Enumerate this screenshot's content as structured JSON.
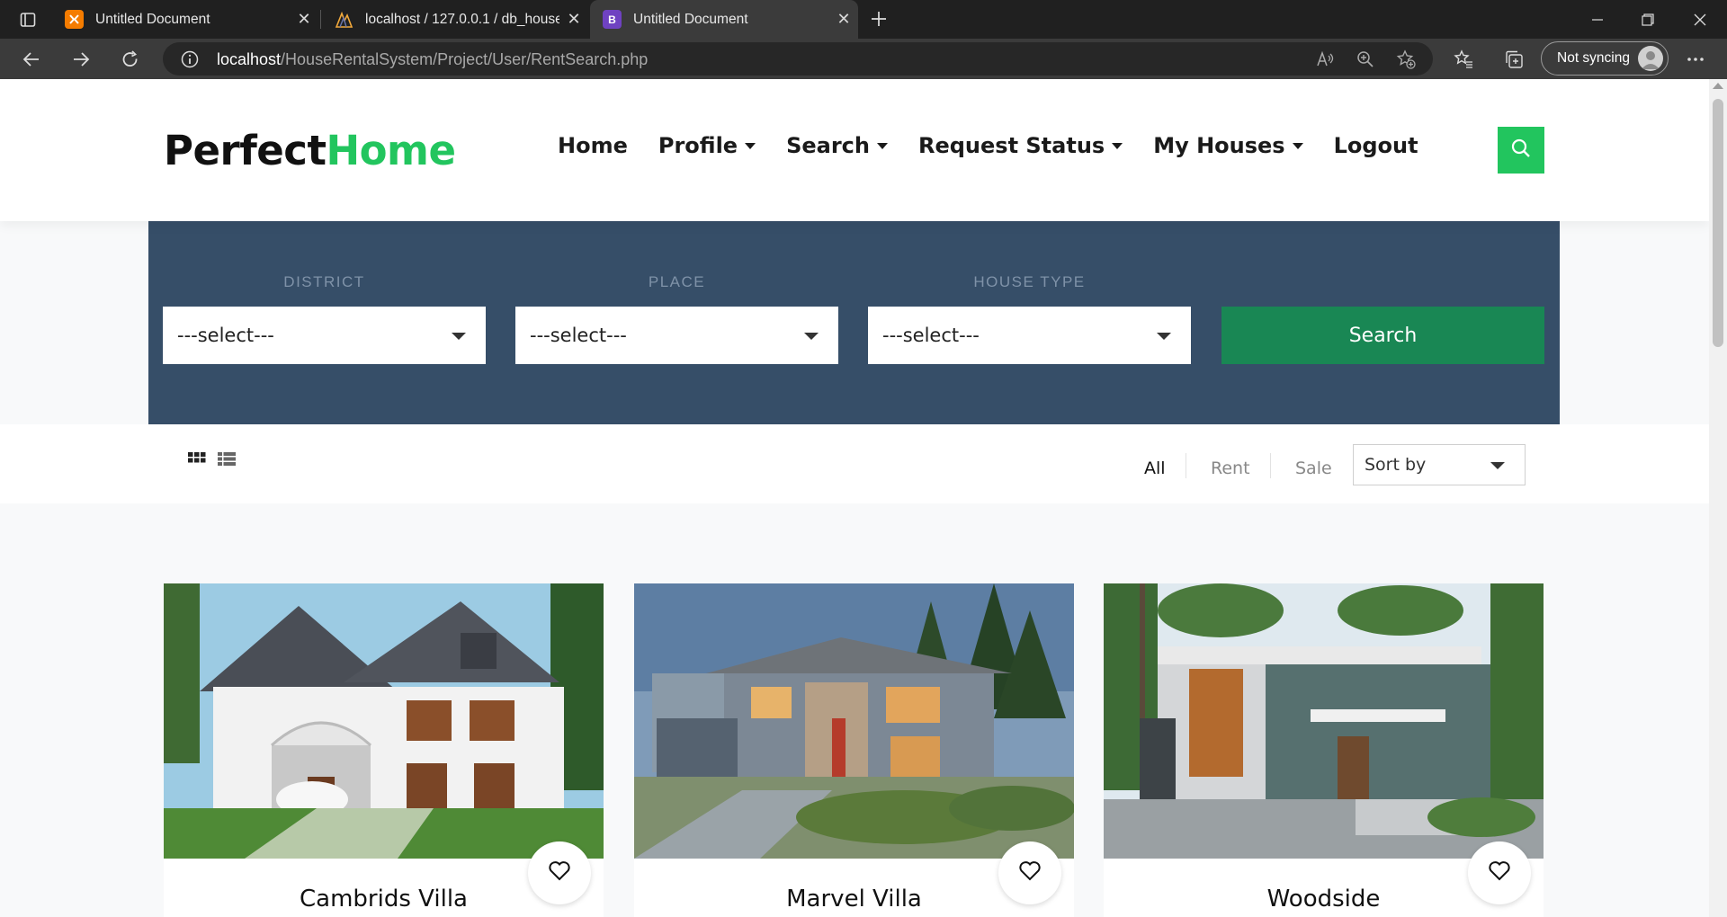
{
  "browser": {
    "tabs": [
      {
        "title": "Untitled Document",
        "favicon": "xampp-icon",
        "active": false
      },
      {
        "title": "localhost / 127.0.0.1 / db_housere",
        "favicon": "phpmyadmin-icon",
        "active": false
      },
      {
        "title": "Untitled Document",
        "favicon": "bootstrap-icon",
        "active": true
      }
    ],
    "url_host": "localhost",
    "url_path": "/HouseRentalSystem/Project/User/RentSearch.php",
    "sync_label": "Not syncing"
  },
  "header": {
    "logo_part1": "Perfect",
    "logo_part2": "Home",
    "nav": {
      "home": "Home",
      "profile": "Profile",
      "search": "Search",
      "request_status": "Request Status",
      "my_houses": "My Houses",
      "logout": "Logout"
    }
  },
  "filters": {
    "district_label": "DISTRICT",
    "place_label": "PLACE",
    "house_type_label": "HOUSE TYPE",
    "district_value": "---select---",
    "place_value": "---select---",
    "house_type_value": "---select---",
    "search_button": "Search"
  },
  "listing_toolbar": {
    "all": "All",
    "rent": "Rent",
    "sale": "Sale",
    "sort_by": "Sort by"
  },
  "properties": [
    {
      "name": "Cambrids Villa"
    },
    {
      "name": "Marvel Villa"
    },
    {
      "name": "Woodside"
    }
  ],
  "colors": {
    "brand_green": "#22c55e",
    "search_button_green": "#198754",
    "filter_panel": "#364e68"
  }
}
